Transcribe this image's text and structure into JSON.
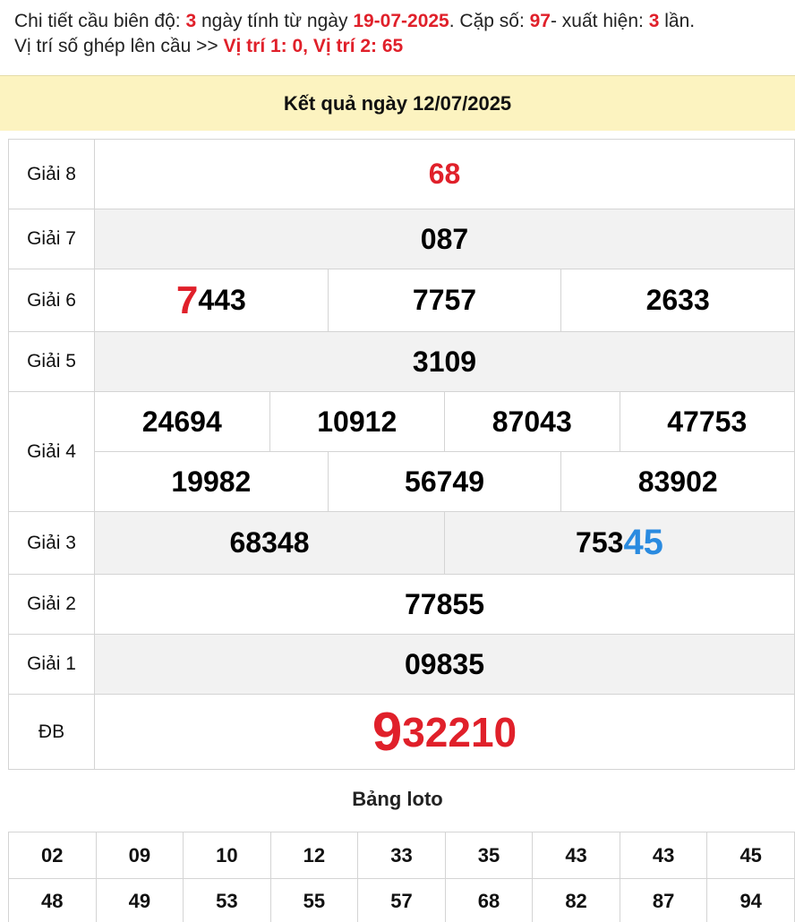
{
  "info": {
    "line1_a": "Chi tiết cầu biên độ: ",
    "days": "3",
    "line1_b": " ngày tính từ ngày ",
    "date": "19-07-2025",
    "line1_c": ". Cặp số: ",
    "pair": "97",
    "line1_d": "- xuất hiện: ",
    "count": "3",
    "line1_e": " lần.",
    "line2_a": "Vị trí số ghép lên cầu >> ",
    "positions": "Vị trí 1: 0, Vị trí 2: 65"
  },
  "result_title": "Kết quả ngày 12/07/2025",
  "prizes": {
    "g8_label": "Giải 8",
    "g8": "68",
    "g7_label": "Giải 7",
    "g7": "087",
    "g6_label": "Giải 6",
    "g6_1_hl": "7",
    "g6_1_rest": "443",
    "g6_2": "7757",
    "g6_3": "2633",
    "g5_label": "Giải 5",
    "g5": "3109",
    "g4_label": "Giải 4",
    "g4_1": "24694",
    "g4_2": "10912",
    "g4_3": "87043",
    "g4_4": "47753",
    "g4_5": "19982",
    "g4_6": "56749",
    "g4_7": "83902",
    "g3_label": "Giải 3",
    "g3_1": "68348",
    "g3_2_rest": "753",
    "g3_2_hl": "45",
    "g2_label": "Giải 2",
    "g2": "77855",
    "g1_label": "Giải 1",
    "g1": "09835",
    "db_label": "ĐB",
    "db_hl": "9",
    "db_rest": "32210"
  },
  "loto_title": "Bảng loto",
  "loto": {
    "r1": [
      "02",
      "09",
      "10",
      "12",
      "33",
      "35",
      "43",
      "43",
      "45"
    ],
    "r2": [
      "48",
      "49",
      "53",
      "55",
      "57",
      "68",
      "82",
      "87",
      "94"
    ]
  },
  "colors": {
    "highlight_red": "#e0202a",
    "highlight_blue": "#2a8be0",
    "header_bg": "#fcf3c0"
  }
}
